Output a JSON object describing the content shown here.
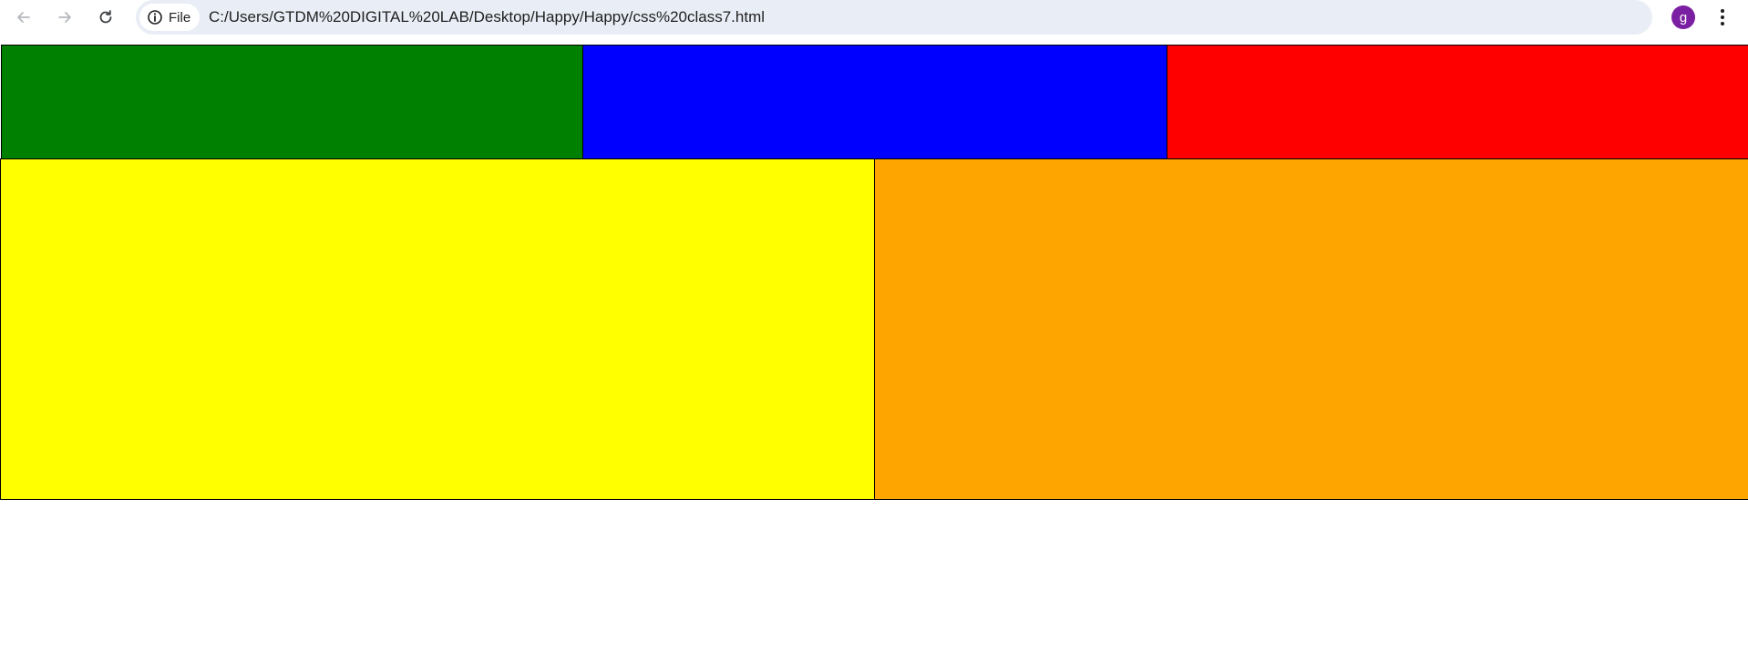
{
  "browser": {
    "site_chip_label": "File",
    "url": "C:/Users/GTDM%20DIGITAL%20LAB/Desktop/Happy/Happy/css%20class7.html",
    "profile_initial": "g",
    "profile_color": "#7b1fa2",
    "icons": {
      "back": "arrow-left-icon",
      "forward": "arrow-right-icon",
      "reload": "reload-icon",
      "site_info": "info-icon",
      "bookmark": "star-icon",
      "menu": "kebab-menu-icon"
    }
  },
  "page": {
    "boxes": [
      {
        "name": "green-box",
        "color": "#008000"
      },
      {
        "name": "blue-box",
        "color": "#0000ff"
      },
      {
        "name": "red-box",
        "color": "#ff0000"
      },
      {
        "name": "yellow-box",
        "color": "#ffff00"
      },
      {
        "name": "orange-box",
        "color": "#ffa500"
      }
    ]
  }
}
